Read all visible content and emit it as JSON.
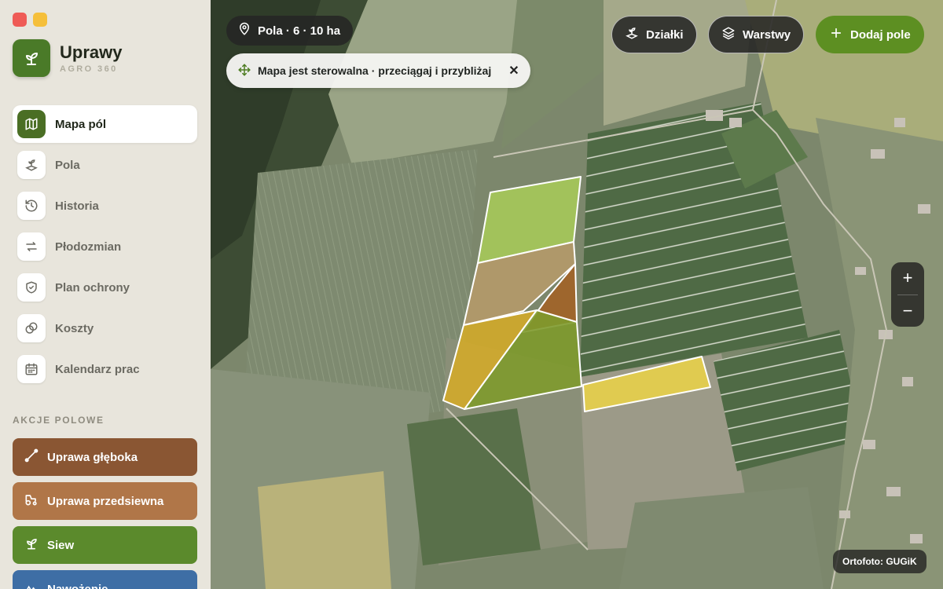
{
  "app": {
    "title": "Uprawy",
    "subtitle": "AGRO 360"
  },
  "sidebar": {
    "nav": [
      {
        "label": "Mapa pól",
        "icon": "map-icon",
        "active": true
      },
      {
        "label": "Pola",
        "icon": "sprout-pin-icon",
        "active": false
      },
      {
        "label": "Historia",
        "icon": "history-icon",
        "active": false
      },
      {
        "label": "Płodozmian",
        "icon": "rotation-icon",
        "active": false
      },
      {
        "label": "Plan ochrony",
        "icon": "shield-icon",
        "active": false
      },
      {
        "label": "Koszty",
        "icon": "coins-icon",
        "active": false
      },
      {
        "label": "Kalendarz prac",
        "icon": "calendar-icon",
        "active": false
      }
    ],
    "section_title": "AKCJE POLOWE",
    "actions": [
      {
        "label": "Uprawa głęboka",
        "icon": "plow-icon",
        "color": "#8a5633"
      },
      {
        "label": "Uprawa przedsiewna",
        "icon": "tractor-icon",
        "color": "#b07648"
      },
      {
        "label": "Siew",
        "icon": "seedling-icon",
        "color": "#5b8a2c"
      },
      {
        "label": "Nawożenie",
        "icon": "fertilizer-icon",
        "color": "#3e6ea5"
      }
    ]
  },
  "map": {
    "fields_chip": "Pola · 6 · 10 ha",
    "info_pill": "Mapa jest sterowalna · przeciągaj i przybliżaj",
    "buttons": {
      "parcels": "Działki",
      "layers": "Warstwy",
      "add_field": "Dodaj pole"
    },
    "zoom_in": "+",
    "zoom_out": "−",
    "credit": "Ortofoto: GUGiK",
    "field_colors": [
      "#a6c95a",
      "#b59a6a",
      "#a0642a",
      "#d2aa2a",
      "#7e9a2c",
      "#e8d04a"
    ]
  }
}
